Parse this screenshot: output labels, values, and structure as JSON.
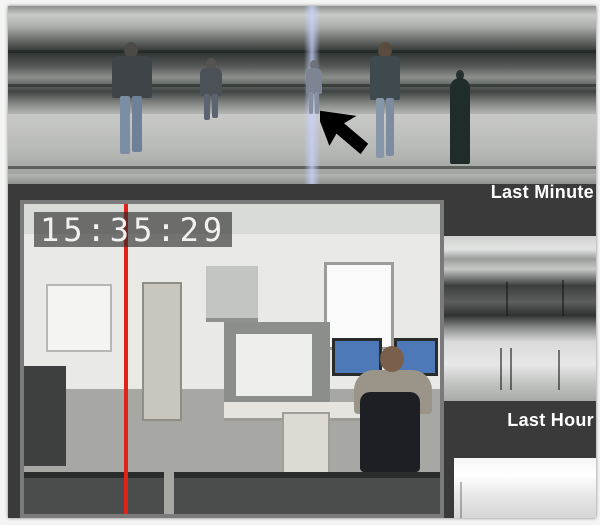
{
  "panels": {
    "last_minute": {
      "label": "Last Minute"
    },
    "last_hour": {
      "label": "Last Hour"
    }
  },
  "live_view": {
    "timestamp": "15:35:29",
    "playhead_color": "#e0231a"
  },
  "icons": {
    "pointer": "pointer-arrow-icon"
  }
}
